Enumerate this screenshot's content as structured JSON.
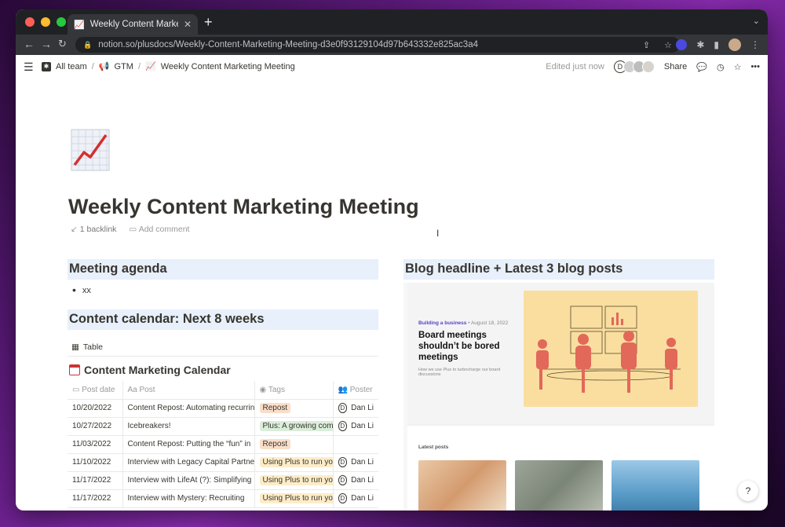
{
  "browser": {
    "tab_title": "Weekly Content Marketing Meeting",
    "url": "notion.so/plusdocs/Weekly-Content-Marketing-Meeting-d3e0f93129104d97b643332e825ac3a4"
  },
  "header": {
    "breadcrumbs": [
      "All team",
      "GTM",
      "Weekly Content Marketing Meeting"
    ],
    "edited": "Edited just now",
    "avatar_initial": "D",
    "share": "Share"
  },
  "page": {
    "title": "Weekly Content Marketing Meeting",
    "backlink": "1 backlink",
    "add_comment": "Add comment"
  },
  "agenda": {
    "heading": "Meeting agenda",
    "items": [
      "xx"
    ]
  },
  "calendar": {
    "heading": "Content calendar: Next 8 weeks",
    "view_label": "Table",
    "db_title": "Content Marketing Calendar",
    "columns": [
      "Post date",
      "Post",
      "Tags",
      "Poster"
    ],
    "rows": [
      {
        "date": "10/20/2022",
        "post": "Content Repost: Automating recurring",
        "tag": "Repost",
        "tag_color": "orange",
        "poster": "Dan Li"
      },
      {
        "date": "10/27/2022",
        "post": "Icebreakers!",
        "tag": "Plus: A growing company",
        "tag_color": "green",
        "poster": "Dan Li"
      },
      {
        "date": "11/03/2022",
        "post": "Content Repost: Putting the “fun” in",
        "tag": "Repost",
        "tag_color": "orange",
        "poster": ""
      },
      {
        "date": "11/10/2022",
        "post": "Interview with Legacy Capital Partners",
        "tag": "Using Plus to run your",
        "tag_color": "yellow",
        "poster": "Dan Li"
      },
      {
        "date": "11/17/2022",
        "post": "Interview with LifeAt (?): Simplifying",
        "tag": "Using Plus to run your",
        "tag_color": "yellow",
        "poster": "Dan Li"
      },
      {
        "date": "11/17/2022",
        "post": "Interview with Mystery: Recruiting",
        "tag": "Using Plus to run your",
        "tag_color": "yellow",
        "poster": "Dan Li"
      }
    ]
  },
  "blog": {
    "heading": "Blog headline + Latest 3 blog posts",
    "category": "Building a business",
    "date": "• August 18, 2022",
    "headline": "Board meetings shouldn’t be bored meetings",
    "subtitle": "How we use Plus to turbocharge our board discussions",
    "latest_label": "Latest posts"
  },
  "help_label": "?",
  "colors": {
    "heading_bg": "#e7f0fb",
    "tag_orange": "#fadec9",
    "tag_green": "#dbeddb",
    "tag_yellow": "#fdecc8",
    "illustration_bg": "#f9dea0",
    "illustration_figure": "#e2685a"
  }
}
